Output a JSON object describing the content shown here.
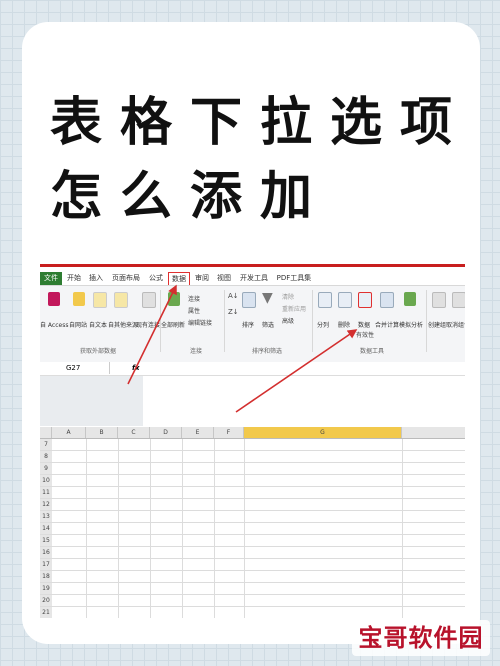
{
  "title": {
    "line1": "表格下拉选项",
    "line2": "怎么添加"
  },
  "tabs": [
    "文件",
    "开始",
    "插入",
    "页面布局",
    "公式",
    "数据",
    "审阅",
    "视图",
    "开发工具",
    "PDF工具集"
  ],
  "active_tab": "数据",
  "ribbon": {
    "get_data": [
      "自 Access",
      "自网站",
      "自文本",
      "自其他来源",
      "现有连接"
    ],
    "refresh": "全部刷新",
    "conn": [
      "连接",
      "属性",
      "编辑链接"
    ],
    "sort": "排序",
    "filter": "筛选",
    "filter_small": [
      "清除",
      "重新应用",
      "高级"
    ],
    "text_to_cols": "分列",
    "remove_dup": "删除",
    "validation": "数据",
    "validation_sub": "有效性",
    "consolidate": "合并计算",
    "whatif": "模拟分析",
    "group": "创建组",
    "ungroup": "取消组合",
    "groups": [
      "获取外部数据",
      "连接",
      "排序和筛选",
      "数据工具"
    ]
  },
  "namebox": "G27",
  "fx": "fx",
  "columns": [
    "A",
    "B",
    "C",
    "D",
    "E",
    "F",
    "G"
  ],
  "selected_column": "G",
  "rows": [
    "7",
    "8",
    "9",
    "10",
    "11",
    "12",
    "13",
    "14",
    "15",
    "16",
    "17",
    "18",
    "19",
    "20",
    "21"
  ],
  "watermark": "宝哥软件园",
  "colors": {
    "red": "#c81e1e",
    "excel_green": "#2e7d32",
    "highlight": "#f2c94c"
  }
}
